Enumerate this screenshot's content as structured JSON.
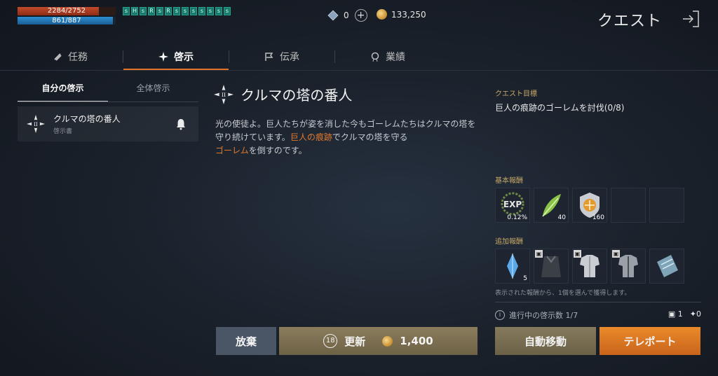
{
  "status": {
    "hp": "2284/2752",
    "hp_ratio": 0.83,
    "mp": "861/887",
    "mp_ratio": 0.97,
    "buffs": [
      "s",
      "H",
      "s",
      "R",
      "s",
      "R",
      "s",
      "s",
      "s",
      "s",
      "s",
      "s",
      "s"
    ]
  },
  "currency": {
    "diamond": "0",
    "gold": "133,250"
  },
  "header": {
    "title": "クエスト"
  },
  "tabs": [
    {
      "label": "任務",
      "icon": "scroll-icon"
    },
    {
      "label": "啓示",
      "icon": "star-icon"
    },
    {
      "label": "伝承",
      "icon": "flag-icon"
    },
    {
      "label": "業績",
      "icon": "medal-icon"
    }
  ],
  "subtabs": [
    "自分の啓示",
    "全体啓示"
  ],
  "quest_list": [
    {
      "name": "クルマの塔の番人",
      "sub": "啓示書"
    }
  ],
  "detail": {
    "title": "クルマの塔の番人",
    "desc_1": "光の使徒よ。巨人たちが姿を消した今もゴーレムたちはクルマの塔を守り続けています。",
    "desc_hl_1": "巨人の痕跡",
    "desc_2": "でクルマの塔を守る",
    "desc_hl_2": "ゴーレム",
    "desc_3": "を倒すのです。"
  },
  "right": {
    "goal_label": "クエスト目標",
    "goal": "巨人の痕跡のゴーレムを討伐(0/8)",
    "basic_label": "基本報酬",
    "basic_rewards": [
      {
        "name": "exp-icon",
        "count": "0.12%",
        "label": "EXP"
      },
      {
        "name": "leaf-icon",
        "count": "40"
      },
      {
        "name": "shield-coin-icon",
        "count": "160"
      },
      {
        "name": "empty",
        "count": ""
      },
      {
        "name": "empty",
        "count": ""
      }
    ],
    "extra_label": "追加報酬",
    "extra_rewards": [
      {
        "name": "crystal-icon",
        "count": "5"
      },
      {
        "name": "cloak-icon",
        "count": ""
      },
      {
        "name": "armor-icon",
        "count": ""
      },
      {
        "name": "armor-dark-icon",
        "count": ""
      },
      {
        "name": "scroll-stone-icon",
        "count": ""
      }
    ],
    "note": "表示された報酬から、1個を選んで獲得します。",
    "progress": "進行中の啓示数 1/7",
    "count_book": "1",
    "count_star": "0"
  },
  "buttons": {
    "abandon": "放棄",
    "refresh_timer": "18",
    "refresh": "更新",
    "refresh_cost": "1,400",
    "auto": "自動移動",
    "teleport": "テレポート"
  },
  "colors": {
    "accent": "#e0722a",
    "highlight": "#e07a2e",
    "label": "#c9a968"
  }
}
